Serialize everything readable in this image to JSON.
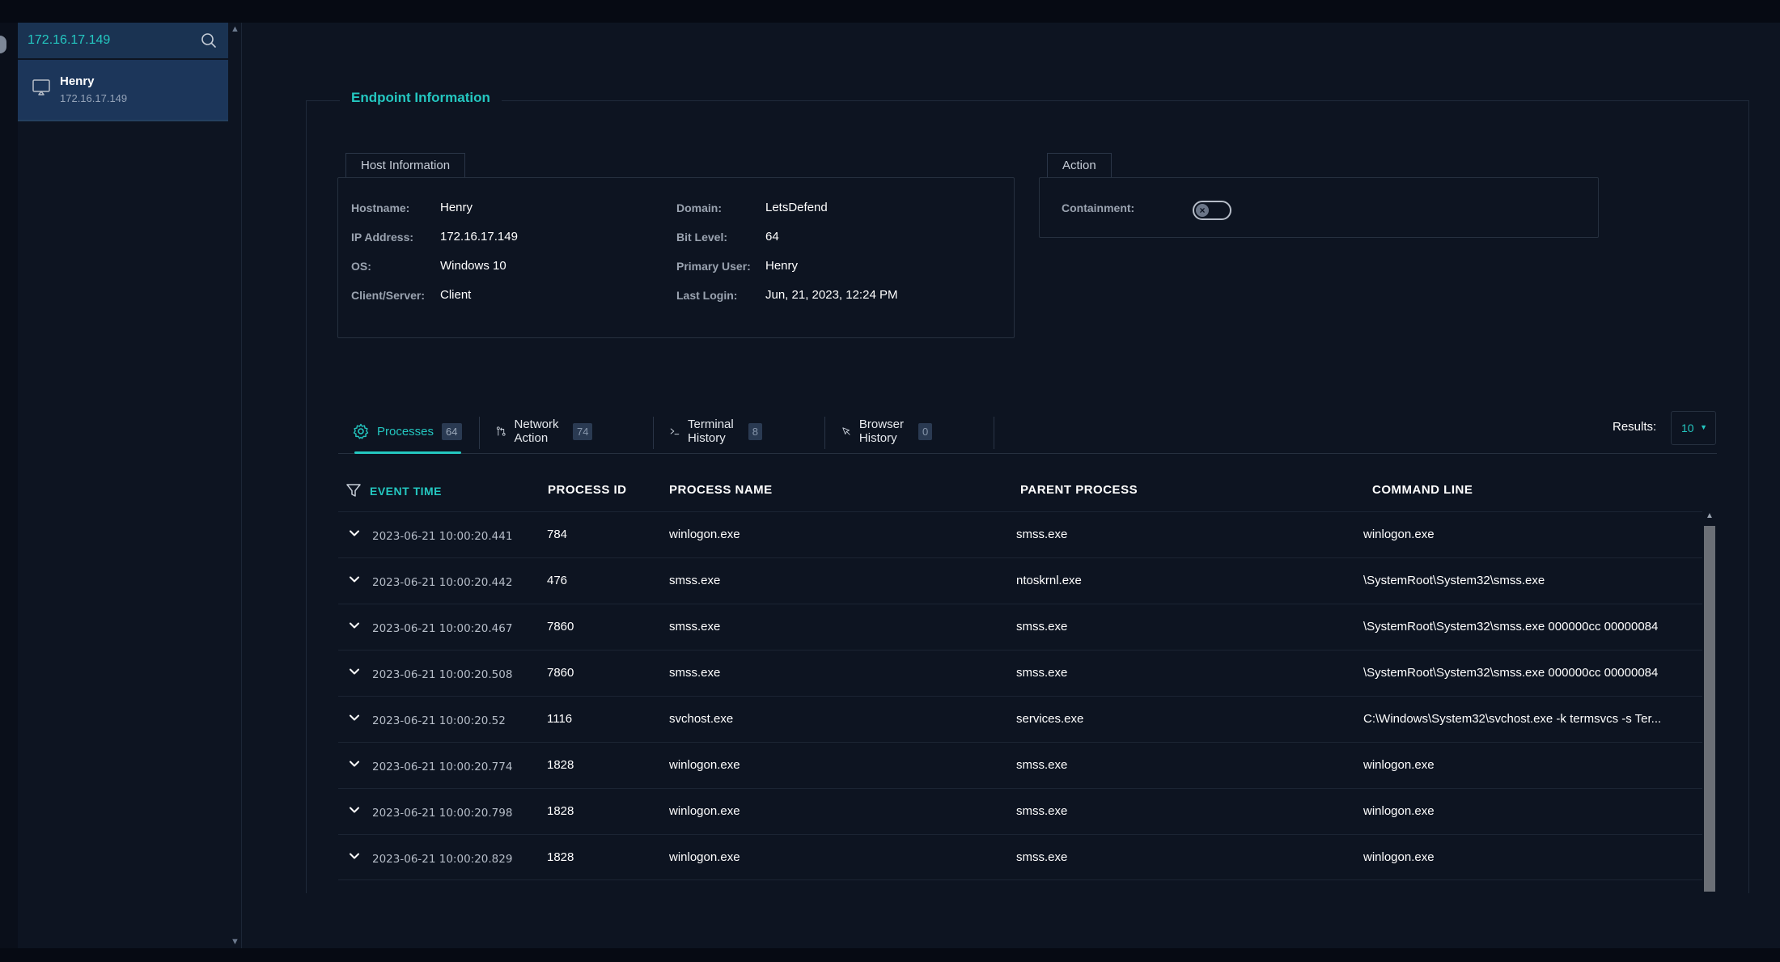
{
  "search": {
    "value": "172.16.17.149"
  },
  "host_list": [
    {
      "name": "Henry",
      "ip": "172.16.17.149"
    }
  ],
  "endpoint": {
    "title": "Endpoint Information",
    "host_info": {
      "legend": "Host Information",
      "left": [
        {
          "label": "Hostname:",
          "value": "Henry"
        },
        {
          "label": "IP Address:",
          "value": "172.16.17.149"
        },
        {
          "label": "OS:",
          "value": "Windows 10"
        },
        {
          "label": "Client/Server:",
          "value": "Client"
        }
      ],
      "right": [
        {
          "label": "Domain:",
          "value": "LetsDefend"
        },
        {
          "label": "Bit Level:",
          "value": "64"
        },
        {
          "label": "Primary User:",
          "value": "Henry"
        },
        {
          "label": "Last Login:",
          "value": "Jun, 21, 2023, 12:24 PM"
        }
      ]
    },
    "action": {
      "legend": "Action",
      "containment_label": "Containment:",
      "containment_on": false
    }
  },
  "tabs": [
    {
      "label": "Processes",
      "count": "64",
      "icon": "gear-icon",
      "active": true
    },
    {
      "label": "Network Action",
      "count": "74",
      "icon": "network-icon",
      "active": false
    },
    {
      "label": "Terminal History",
      "count": "8",
      "icon": "terminal-icon",
      "active": false
    },
    {
      "label": "Browser History",
      "count": "0",
      "icon": "cursor-icon",
      "active": false
    }
  ],
  "results": {
    "label": "Results:",
    "value": "10"
  },
  "table": {
    "columns": [
      "EVENT TIME",
      "PROCESS ID",
      "PROCESS NAME",
      "PARENT PROCESS",
      "COMMAND LINE"
    ],
    "rows": [
      {
        "time": "2023-06-21 10:00:20.441",
        "pid": "784",
        "name": "winlogon.exe",
        "parent": "smss.exe",
        "cmd": "winlogon.exe"
      },
      {
        "time": "2023-06-21 10:00:20.442",
        "pid": "476",
        "name": "smss.exe",
        "parent": "ntoskrnl.exe",
        "cmd": "\\SystemRoot\\System32\\smss.exe"
      },
      {
        "time": "2023-06-21 10:00:20.467",
        "pid": "7860",
        "name": "smss.exe",
        "parent": "smss.exe",
        "cmd": "\\SystemRoot\\System32\\smss.exe 000000cc 00000084"
      },
      {
        "time": "2023-06-21 10:00:20.508",
        "pid": "7860",
        "name": "smss.exe",
        "parent": "smss.exe",
        "cmd": "\\SystemRoot\\System32\\smss.exe 000000cc 00000084"
      },
      {
        "time": "2023-06-21 10:00:20.52",
        "pid": "1116",
        "name": "svchost.exe",
        "parent": "services.exe",
        "cmd": "C:\\Windows\\System32\\svchost.exe -k termsvcs -s Ter..."
      },
      {
        "time": "2023-06-21 10:00:20.774",
        "pid": "1828",
        "name": "winlogon.exe",
        "parent": "smss.exe",
        "cmd": "winlogon.exe"
      },
      {
        "time": "2023-06-21 10:00:20.798",
        "pid": "1828",
        "name": "winlogon.exe",
        "parent": "smss.exe",
        "cmd": "winlogon.exe"
      },
      {
        "time": "2023-06-21 10:00:20.829",
        "pid": "1828",
        "name": "winlogon.exe",
        "parent": "smss.exe",
        "cmd": "winlogon.exe"
      }
    ]
  }
}
